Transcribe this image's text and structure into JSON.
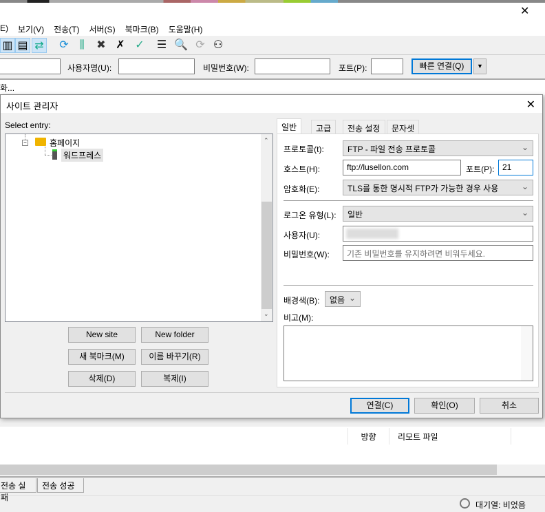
{
  "window": {
    "close_icon": "close-icon"
  },
  "menu": [
    "E)",
    "보기(V)",
    "전송(T)",
    "서버(S)",
    "북마크(B)",
    "도움말(H)"
  ],
  "quickconnect": {
    "username_label": "사용자명(U):",
    "password_label": "비밀번호(W):",
    "port_label": "포트(P):",
    "connect_label": "빠른 연결(Q)"
  },
  "message_log": "화...",
  "dialog": {
    "title": "사이트 관리자",
    "select_entry": "Select entry:",
    "tree": [
      {
        "label": "홈페이지",
        "type": "folder"
      },
      {
        "label": "워드프레스",
        "type": "server",
        "selected": true
      }
    ],
    "buttons": {
      "new_site": "New site",
      "new_folder": "New folder",
      "new_bookmark": "새 북마크(M)",
      "rename": "이름 바꾸기(R)",
      "delete": "삭제(D)",
      "duplicate": "복제(I)"
    },
    "tabs": [
      "일반",
      "고급",
      "전송 설정",
      "문자셋"
    ],
    "general": {
      "protocol_label": "프로토콜(t):",
      "protocol_value": "FTP - 파일 전송 프로토콜",
      "host_label": "호스트(H):",
      "host_value": "ftp://lusellon.com",
      "port_label": "포트(P):",
      "port_value": "21",
      "encryption_label": "암호화(E):",
      "encryption_value": "TLS를 통한 명시적 FTP가 가능한 경우 사용",
      "logon_label": "로그온 유형(L):",
      "logon_value": "일반",
      "user_label": "사용자(U):",
      "user_value": "",
      "password_label": "비밀번호(W):",
      "password_placeholder": "기존 비밀번호를 유지하려면 비워두세요.",
      "bgcolor_label": "배경색(B):",
      "bgcolor_value": "없음",
      "comments_label": "비고(M):"
    },
    "footer": {
      "connect": "연결(C)",
      "ok": "확인(O)",
      "cancel": "취소"
    }
  },
  "queue": {
    "columns": [
      "방향",
      "리모트 파일"
    ],
    "tabs": [
      "전송 실패",
      "전송 성공"
    ]
  },
  "status": {
    "queue": "대기열: 비었음"
  },
  "colors": {
    "accent": "#0078d7",
    "folder": "#f0b400"
  }
}
